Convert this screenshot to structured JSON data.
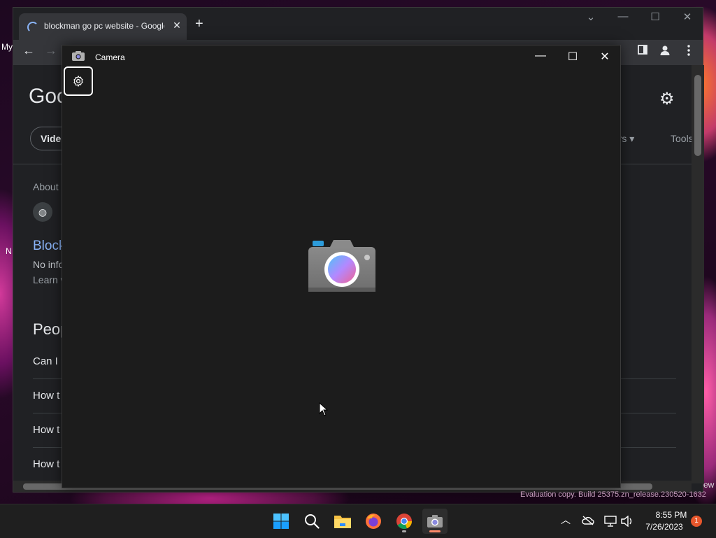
{
  "desktop": {
    "left_labels": [
      "My",
      "N"
    ],
    "right_label": "ew"
  },
  "chrome": {
    "tab_title": "blockman go pc website - Google",
    "tab_close": "✕",
    "new_tab": "+",
    "tab_search": "⌄",
    "minimize": "—",
    "maximize": "☐",
    "close": "✕",
    "nav": {
      "back": "←",
      "forward": "→"
    },
    "page": {
      "logo_partial": "Goo",
      "chip_partial": "Video",
      "filters_partial": "ters ▾",
      "tools": "Tools",
      "about_partial": "About",
      "result_title_partial": "Block",
      "result_line1_partial": "No info",
      "result_line2_partial": "Learn w",
      "paa_heading_partial": "Peop",
      "questions": [
        "Can I p",
        "How t",
        "How t",
        "How t"
      ]
    }
  },
  "camera": {
    "title": "Camera",
    "minimize": "—",
    "maximize": "☐",
    "close": "✕"
  },
  "watermark": "Evaluation copy. Build 25375.zn_release.230520-1632",
  "taskbar": {
    "time": "8:55 PM",
    "date": "7/26/2023",
    "notification_count": "1",
    "tray_chevron": "︿"
  },
  "colors": {
    "accent_blue": "#8ab4f8",
    "camera_bg": "#1c1c1c",
    "badge": "#e8572c"
  }
}
